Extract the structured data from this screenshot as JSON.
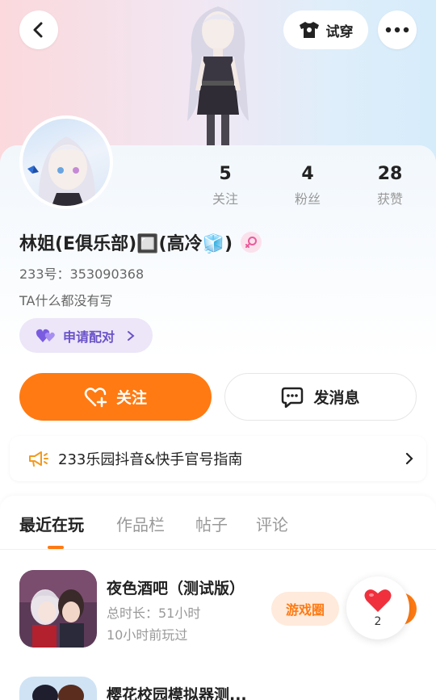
{
  "header": {
    "tryon_label": "试穿"
  },
  "stats": [
    {
      "value": "5",
      "label": "关注"
    },
    {
      "value": "4",
      "label": "粉丝"
    },
    {
      "value": "28",
      "label": "获赞"
    }
  ],
  "profile": {
    "name": "林姐(E俱乐部)🔲(高冷🧊)",
    "uid_text": "233号：353090368",
    "bio": "TA什么都没有写",
    "pair_label": "申请配对"
  },
  "actions": {
    "follow_label": "关注",
    "message_label": "发消息"
  },
  "notice": {
    "text": "233乐园抖音&快手官号指南"
  },
  "tabs": [
    {
      "label": "最近在玩",
      "active": true
    },
    {
      "label": "作品栏",
      "active": false
    },
    {
      "label": "帖子",
      "active": false
    },
    {
      "label": "评论",
      "active": false
    }
  ],
  "games": [
    {
      "title": "夜色酒吧（测试版）",
      "playtime": "总时长：51小时",
      "last_played": "10小时前玩过",
      "circle_label": "游戏圈"
    },
    {
      "title": "樱花校园模拟器测..."
    }
  ],
  "like_widget": {
    "count": "2"
  },
  "colors": {
    "accent": "#ff7a12",
    "pair_purple": "#6a52c8",
    "pair_bg": "#ece6f8",
    "gender_pink": "#fbe1ec"
  }
}
